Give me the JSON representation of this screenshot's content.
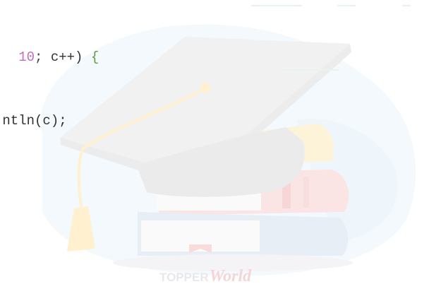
{
  "code": {
    "line1": {
      "num": "10",
      "semicolon": ";",
      "var": "c++)",
      "brace": "{"
    },
    "line2": "ntln(c);"
  },
  "watermark": {
    "brand_left": "TOPPER",
    "brand_right": "World",
    "illustration": "graduation-cap-on-books-icon"
  },
  "colors": {
    "number": "#c06fbf",
    "brace": "#5c9a47",
    "text": "#333333",
    "blob": "#eef7fb",
    "cap": "#f1f1f1",
    "tassel": "#fff1cf"
  }
}
